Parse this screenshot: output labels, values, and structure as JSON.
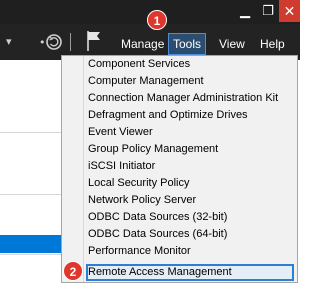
{
  "window": {
    "minimize_glyph": "▁",
    "maximize_glyph": "❐",
    "close_glyph": "✕"
  },
  "toolbar": {
    "chevron_glyph": "▾",
    "menus": {
      "manage": "Manage",
      "tools": "Tools",
      "view": "View",
      "help": "Help"
    }
  },
  "badges": {
    "step1": "1",
    "step2": "2"
  },
  "dropdown": {
    "items": [
      "Component Services",
      "Computer Management",
      "Connection Manager Administration Kit",
      "Defragment and Optimize Drives",
      "Event Viewer",
      "Group Policy Management",
      "iSCSI Initiator",
      "Local Security Policy",
      "Network Policy Server",
      "ODBC Data Sources (32-bit)",
      "ODBC Data Sources (64-bit)",
      "Performance Monitor",
      "Remote Access Management"
    ],
    "selected": "Remote Access Management"
  },
  "colors": {
    "toolbar_bg": "#232323",
    "accent_blue": "#2f7fd1",
    "badge_red": "#e0362b",
    "close_red": "#d03b2f"
  }
}
